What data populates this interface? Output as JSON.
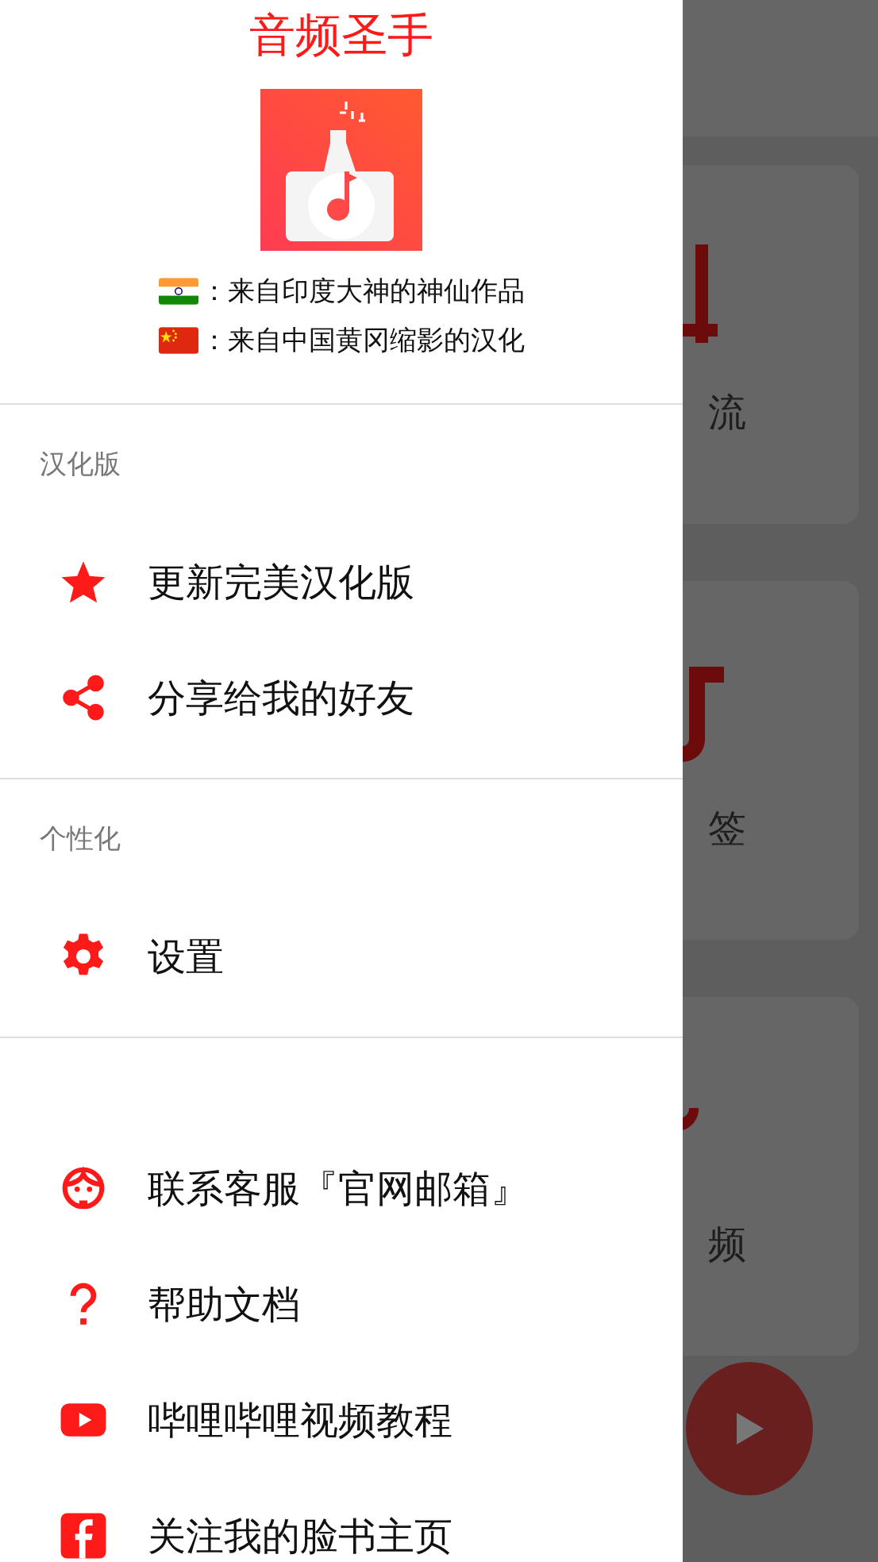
{
  "drawer": {
    "title": "音频圣手",
    "credits": [
      {
        "kind": "india",
        "text": "：来自印度大神的神仙作品"
      },
      {
        "kind": "china",
        "text": "：来自中国黄冈缩影的汉化"
      }
    ],
    "sections": [
      {
        "header": "汉化版",
        "items": [
          {
            "kind": "star",
            "label": "更新完美汉化版"
          },
          {
            "kind": "share",
            "label": "分享给我的好友"
          }
        ]
      },
      {
        "header": "个性化",
        "items": [
          {
            "kind": "gear",
            "label": "设置"
          }
        ]
      },
      {
        "items": [
          {
            "kind": "headset",
            "label": "联系客服『官网邮箱』"
          },
          {
            "kind": "question",
            "label": "帮助文档"
          },
          {
            "kind": "video",
            "label": "哔哩哔哩视频教程"
          },
          {
            "kind": "facebook",
            "label": "关注我的脸书主页"
          }
        ]
      }
    ]
  },
  "background": {
    "cards": [
      {
        "kind": "mix",
        "label": "流"
      },
      {
        "kind": "tag",
        "label": "签"
      },
      {
        "kind": "audio",
        "label": "频"
      }
    ]
  }
}
